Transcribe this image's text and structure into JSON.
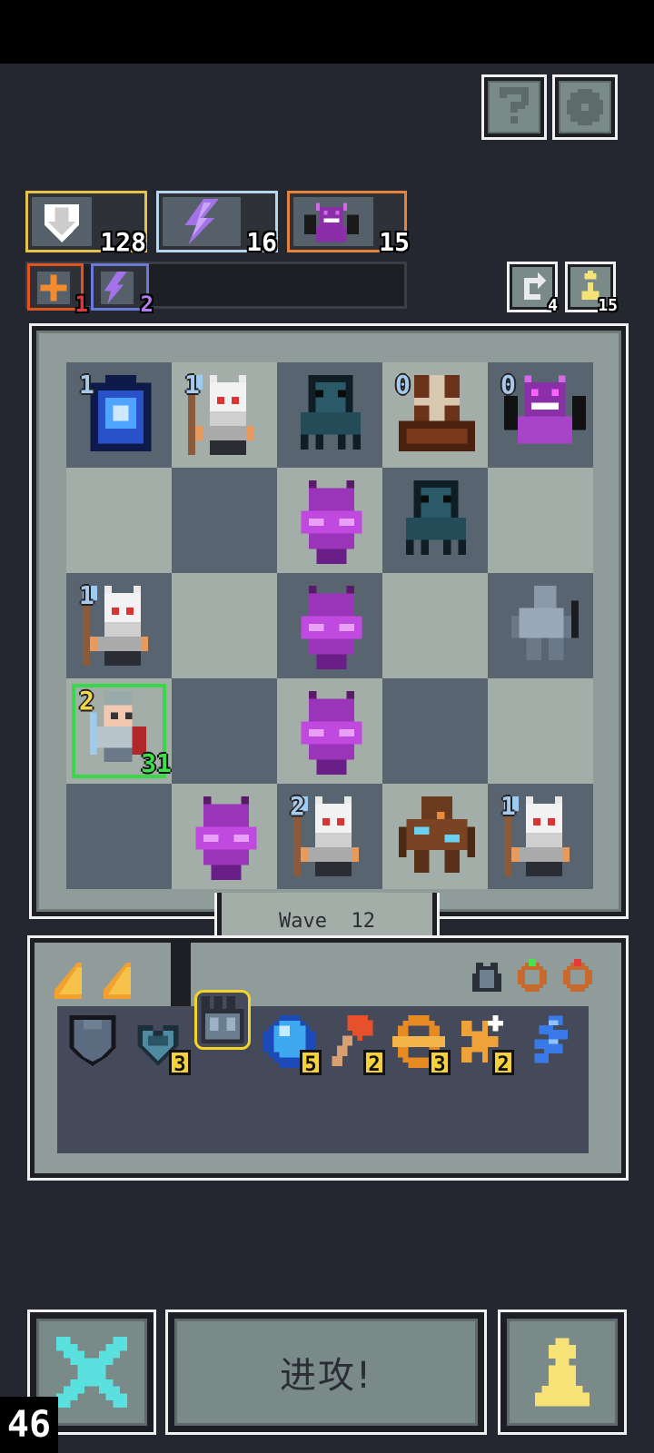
{
  "header": {
    "help_icon": "question-icon",
    "settings_icon": "gear-icon"
  },
  "resources": [
    {
      "name": "defense",
      "value": "128",
      "border": "#e7c24a",
      "icon": "shield-down-icon"
    },
    {
      "name": "energy",
      "value": "16",
      "border": "#b8d6e8",
      "icon": "lightning-icon"
    },
    {
      "name": "demon",
      "value": "15",
      "border": "#e6823c",
      "icon": "demon-icon"
    }
  ],
  "buffs": [
    {
      "value": "1",
      "icon": "fire-plus-icon",
      "color": "#e2541f"
    },
    {
      "value": "2",
      "icon": "lightning-plus-icon",
      "color": "#a472e8"
    }
  ],
  "counters": {
    "refresh": "4",
    "pawn": "15"
  },
  "board": {
    "rows": [
      [
        {
          "lvl": "1",
          "unit": "blue-totem"
        },
        {
          "lvl": "1",
          "unit": "skeleton-mage"
        },
        {
          "lvl": "",
          "unit": "cthulhu"
        },
        {
          "lvl": "0",
          "unit": "barrel-spider"
        },
        {
          "lvl": "0",
          "unit": "purple-demon"
        }
      ],
      [
        {
          "lvl": "",
          "unit": ""
        },
        {
          "lvl": "",
          "unit": ""
        },
        {
          "lvl": "",
          "unit": "purple-wraith"
        },
        {
          "lvl": "",
          "unit": "cthulhu"
        },
        {
          "lvl": "",
          "unit": ""
        }
      ],
      [
        {
          "lvl": "1",
          "unit": "skeleton-mage"
        },
        {
          "lvl": "",
          "unit": ""
        },
        {
          "lvl": "",
          "unit": "purple-wraith"
        },
        {
          "lvl": "",
          "unit": ""
        },
        {
          "lvl": "",
          "unit": "stone-gargoyle"
        }
      ],
      [
        {
          "lvl": "2",
          "unit": "knight-hero",
          "hp": "31"
        },
        {
          "lvl": "",
          "unit": ""
        },
        {
          "lvl": "",
          "unit": "purple-wraith"
        },
        {
          "lvl": "",
          "unit": ""
        },
        {
          "lvl": "",
          "unit": ""
        }
      ],
      [
        {
          "lvl": "",
          "unit": ""
        },
        {
          "lvl": "",
          "unit": "purple-wraith"
        },
        {
          "lvl": "2",
          "unit": "skeleton-mage"
        },
        {
          "lvl": "",
          "unit": "wood-golem"
        },
        {
          "lvl": "1",
          "unit": "skeleton-mage"
        }
      ]
    ],
    "wave_label": "Wave  12"
  },
  "inventory": {
    "tabs": [
      "card-tab",
      "card-tab"
    ],
    "equipped": [
      "armor-icon",
      "green-ring-icon",
      "red-ring-icon"
    ],
    "items": [
      {
        "icon": "shield-icon",
        "count": ""
      },
      {
        "icon": "heart-gem-icon",
        "count": "3"
      },
      {
        "icon": "crown-icon",
        "count": ""
      },
      {
        "icon": "blue-orb-icon",
        "count": "5"
      },
      {
        "icon": "axe-icon",
        "count": "2"
      },
      {
        "icon": "orange-orb-icon",
        "count": "3"
      },
      {
        "icon": "burst-plus-icon",
        "count": "2"
      },
      {
        "icon": "blue-swirl-icon",
        "count": ""
      }
    ]
  },
  "controls": {
    "attack_label": "进攻!",
    "cancel_icon": "x-icon",
    "pawn_icon": "pawn-icon"
  },
  "fps": "46"
}
